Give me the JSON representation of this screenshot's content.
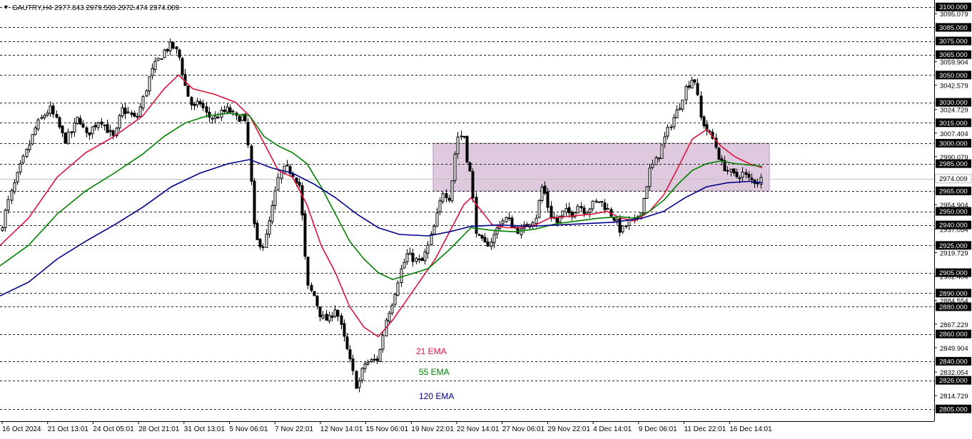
{
  "header": {
    "marker": "▼",
    "symbol_tf": "GAUTRY,H4",
    "ohlc": "2977.843 2979.593 2972.474 2974.009"
  },
  "chart_data": {
    "type": "candlestick",
    "title": "GAUTRY,H4",
    "ylim": [
      2796,
      3103
    ],
    "grid": "dashed horizontal levels",
    "x_ticks": [
      "16 Oct 2024",
      "21 Oct 13:01",
      "24 Oct 05:01",
      "28 Oct 21:01",
      "31 Oct 13:01",
      "5 Nov 06:01",
      "7 Nov 22:01",
      "12 Nov 14:01",
      "15 Nov 06:01",
      "19 Nov 22:01",
      "22 Nov 14:01",
      "27 Nov 06:01",
      "29 Nov 22:01",
      "4 Dec 14:01",
      "9 Dec 06:01",
      "11 Dec 22:01",
      "16 Dec 14:01"
    ],
    "y_ticks_plain": [
      "3095.079",
      "3059.904",
      "3042.579",
      "3024.729",
      "3007.404",
      "2990.079",
      "2954.904",
      "2937.054",
      "2919.729",
      "2902.404",
      "2884.554",
      "2867.229",
      "2849.904",
      "2832.054",
      "2814.729"
    ],
    "levels": [
      3100,
      3085,
      3075,
      3065,
      3050,
      3030,
      3015,
      3000,
      2985,
      2965,
      2950,
      2940,
      2925,
      2905,
      2890,
      2880,
      2860,
      2840,
      2826,
      2805
    ],
    "level_labels": [
      "3100.000",
      "3085.000",
      "3075.000",
      "3065.000",
      "3050.000",
      "3030.000",
      "3015.000",
      "3000.000",
      "2985.000",
      "2965.000",
      "2950.000",
      "2940.000",
      "2925.000",
      "2905.000",
      "2890.000",
      "2880.000",
      "2860.000",
      "2840.000",
      "2826.000",
      "2805.000"
    ],
    "current_price": "2974.009",
    "zone": {
      "from": 2965,
      "to": 3000,
      "color": "#d8bfd8"
    },
    "close_path": [
      [
        0,
        2935
      ],
      [
        10,
        2955
      ],
      [
        20,
        2970
      ],
      [
        30,
        2985
      ],
      [
        40,
        2998
      ],
      [
        50,
        3012
      ],
      [
        60,
        3020
      ],
      [
        70,
        3025
      ],
      [
        80,
        3015
      ],
      [
        90,
        3002
      ],
      [
        100,
        3008
      ],
      [
        110,
        3020
      ],
      [
        120,
        3005
      ],
      [
        130,
        3012
      ],
      [
        140,
        3018
      ],
      [
        150,
        3010
      ],
      [
        160,
        3003
      ],
      [
        170,
        3025
      ],
      [
        180,
        3022
      ],
      [
        190,
        3017
      ],
      [
        200,
        3032
      ],
      [
        210,
        3050
      ],
      [
        220,
        3060
      ],
      [
        230,
        3068
      ],
      [
        240,
        3072
      ],
      [
        250,
        3065
      ],
      [
        260,
        3040
      ],
      [
        270,
        3025
      ],
      [
        280,
        3030
      ],
      [
        290,
        3020
      ],
      [
        300,
        3018
      ],
      [
        310,
        3022
      ],
      [
        320,
        3025
      ],
      [
        330,
        3018
      ],
      [
        340,
        3020
      ],
      [
        345,
        3010
      ],
      [
        350,
        2985
      ],
      [
        355,
        2940
      ],
      [
        360,
        2928
      ],
      [
        370,
        2925
      ],
      [
        380,
        2950
      ],
      [
        390,
        2975
      ],
      [
        400,
        2982
      ],
      [
        410,
        2978
      ],
      [
        420,
        2968
      ],
      [
        430,
        2895
      ],
      [
        440,
        2888
      ],
      [
        450,
        2872
      ],
      [
        460,
        2870
      ],
      [
        470,
        2880
      ],
      [
        480,
        2860
      ],
      [
        490,
        2840
      ],
      [
        500,
        2820
      ],
      [
        510,
        2838
      ],
      [
        520,
        2840
      ],
      [
        530,
        2842
      ],
      [
        540,
        2870
      ],
      [
        550,
        2885
      ],
      [
        560,
        2905
      ],
      [
        570,
        2918
      ],
      [
        580,
        2915
      ],
      [
        590,
        2912
      ],
      [
        600,
        2925
      ],
      [
        610,
        2942
      ],
      [
        620,
        2965
      ],
      [
        630,
        2960
      ],
      [
        640,
        3005
      ],
      [
        650,
        3005
      ],
      [
        655,
        2985
      ],
      [
        660,
        2975
      ],
      [
        665,
        2940
      ],
      [
        670,
        2930
      ],
      [
        680,
        2925
      ],
      [
        690,
        2930
      ],
      [
        700,
        2942
      ],
      [
        710,
        2945
      ],
      [
        720,
        2938
      ],
      [
        730,
        2935
      ],
      [
        740,
        2942
      ],
      [
        750,
        2945
      ],
      [
        760,
        2970
      ],
      [
        770,
        2948
      ],
      [
        780,
        2942
      ],
      [
        790,
        2950
      ],
      [
        800,
        2948
      ],
      [
        810,
        2955
      ],
      [
        820,
        2950
      ],
      [
        830,
        2955
      ],
      [
        840,
        2958
      ],
      [
        850,
        2952
      ],
      [
        860,
        2945
      ],
      [
        870,
        2935
      ],
      [
        880,
        2942
      ],
      [
        890,
        2942
      ],
      [
        900,
        2955
      ],
      [
        910,
        2980
      ],
      [
        920,
        2988
      ],
      [
        930,
        3002
      ],
      [
        940,
        3015
      ],
      [
        950,
        3025
      ],
      [
        960,
        3040
      ],
      [
        970,
        3048
      ],
      [
        975,
        3045
      ],
      [
        980,
        3020
      ],
      [
        990,
        3010
      ],
      [
        1000,
        3002
      ],
      [
        1010,
        2985
      ],
      [
        1020,
        2980
      ],
      [
        1030,
        2975
      ],
      [
        1040,
        2978
      ],
      [
        1050,
        2973
      ],
      [
        1060,
        2972
      ],
      [
        1068,
        2974
      ]
    ],
    "series": [
      {
        "name": "21 EMA",
        "color": "#dc143c",
        "values": [
          [
            0,
            2925
          ],
          [
            40,
            2945
          ],
          [
            80,
            2975
          ],
          [
            120,
            2993
          ],
          [
            160,
            3005
          ],
          [
            200,
            3020
          ],
          [
            230,
            3040
          ],
          [
            250,
            3050
          ],
          [
            270,
            3040
          ],
          [
            300,
            3036
          ],
          [
            330,
            3030
          ],
          [
            350,
            3020
          ],
          [
            370,
            3000
          ],
          [
            390,
            2980
          ],
          [
            410,
            2975
          ],
          [
            430,
            2955
          ],
          [
            450,
            2925
          ],
          [
            470,
            2905
          ],
          [
            490,
            2880
          ],
          [
            510,
            2865
          ],
          [
            530,
            2858
          ],
          [
            550,
            2870
          ],
          [
            570,
            2885
          ],
          [
            590,
            2900
          ],
          [
            610,
            2915
          ],
          [
            630,
            2935
          ],
          [
            650,
            2955
          ],
          [
            660,
            2960
          ],
          [
            675,
            2950
          ],
          [
            690,
            2940
          ],
          [
            710,
            2938
          ],
          [
            730,
            2938
          ],
          [
            750,
            2940
          ],
          [
            770,
            2945
          ],
          [
            790,
            2946
          ],
          [
            810,
            2947
          ],
          [
            830,
            2948
          ],
          [
            850,
            2950
          ],
          [
            870,
            2945
          ],
          [
            890,
            2943
          ],
          [
            910,
            2950
          ],
          [
            930,
            2962
          ],
          [
            950,
            2982
          ],
          [
            970,
            3003
          ],
          [
            990,
            3010
          ],
          [
            1010,
            2998
          ],
          [
            1030,
            2990
          ],
          [
            1050,
            2985
          ],
          [
            1068,
            2982
          ]
        ]
      },
      {
        "name": "55 EMA",
        "color": "#008000",
        "values": [
          [
            0,
            2910
          ],
          [
            40,
            2925
          ],
          [
            80,
            2948
          ],
          [
            120,
            2965
          ],
          [
            160,
            2978
          ],
          [
            200,
            2992
          ],
          [
            230,
            3005
          ],
          [
            260,
            3015
          ],
          [
            290,
            3020
          ],
          [
            320,
            3022
          ],
          [
            350,
            3020
          ],
          [
            370,
            3005
          ],
          [
            390,
            2998
          ],
          [
            410,
            2993
          ],
          [
            430,
            2985
          ],
          [
            450,
            2968
          ],
          [
            470,
            2948
          ],
          [
            490,
            2928
          ],
          [
            510,
            2915
          ],
          [
            530,
            2905
          ],
          [
            550,
            2900
          ],
          [
            570,
            2903
          ],
          [
            600,
            2908
          ],
          [
            630,
            2922
          ],
          [
            660,
            2938
          ],
          [
            690,
            2936
          ],
          [
            720,
            2935
          ],
          [
            750,
            2937
          ],
          [
            780,
            2941
          ],
          [
            810,
            2943
          ],
          [
            840,
            2945
          ],
          [
            870,
            2946
          ],
          [
            890,
            2945
          ],
          [
            910,
            2950
          ],
          [
            930,
            2958
          ],
          [
            950,
            2970
          ],
          [
            970,
            2980
          ],
          [
            990,
            2985
          ],
          [
            1010,
            2987
          ],
          [
            1030,
            2985
          ],
          [
            1050,
            2984
          ],
          [
            1068,
            2983
          ]
        ]
      },
      {
        "name": "120 EMA",
        "color": "#00008b",
        "values": [
          [
            0,
            2888
          ],
          [
            40,
            2898
          ],
          [
            80,
            2915
          ],
          [
            120,
            2928
          ],
          [
            160,
            2940
          ],
          [
            200,
            2953
          ],
          [
            240,
            2968
          ],
          [
            280,
            2978
          ],
          [
            320,
            2985
          ],
          [
            350,
            2988
          ],
          [
            380,
            2982
          ],
          [
            410,
            2978
          ],
          [
            440,
            2970
          ],
          [
            470,
            2960
          ],
          [
            500,
            2948
          ],
          [
            530,
            2938
          ],
          [
            560,
            2933
          ],
          [
            600,
            2932
          ],
          [
            630,
            2935
          ],
          [
            660,
            2939
          ],
          [
            700,
            2940
          ],
          [
            740,
            2939
          ],
          [
            780,
            2940
          ],
          [
            820,
            2941
          ],
          [
            860,
            2942
          ],
          [
            900,
            2945
          ],
          [
            930,
            2950
          ],
          [
            960,
            2960
          ],
          [
            990,
            2968
          ],
          [
            1020,
            2971
          ],
          [
            1050,
            2972
          ],
          [
            1068,
            2971
          ]
        ]
      }
    ],
    "annotations": [
      "21 EMA",
      "55 EMA",
      "120 EMA"
    ]
  }
}
